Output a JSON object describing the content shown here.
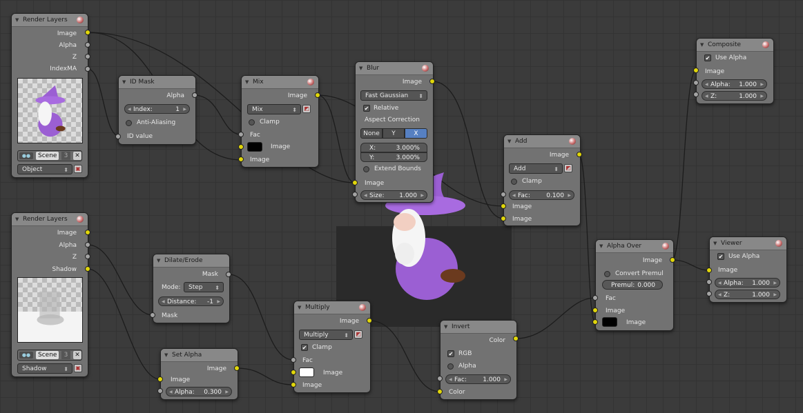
{
  "nodes": {
    "render_layers_1": {
      "title": "Render Layers",
      "outputs": [
        "Image",
        "Alpha",
        "Z",
        "IndexMA"
      ],
      "scene_name": "Scene",
      "scene_users": "3",
      "layer_select": "Object"
    },
    "id_mask": {
      "title": "ID Mask",
      "output": "Alpha",
      "index_label": "Index:",
      "index_value": "1",
      "anti_aliasing": "Anti-Aliasing",
      "input": "ID value"
    },
    "mix": {
      "title": "Mix",
      "output": "Image",
      "blend": "Mix",
      "clamp": "Clamp",
      "inputs": [
        "Fac",
        "Image",
        "Image"
      ]
    },
    "blur": {
      "title": "Blur",
      "output": "Image",
      "filter": "Fast Gaussian",
      "relative": "Relative",
      "aspect_label": "Aspect Correction",
      "aspect_options": [
        "None",
        "Y",
        "X"
      ],
      "x_label": "X:",
      "x_value": "3.000%",
      "y_label": "Y:",
      "y_value": "3.000%",
      "extend_bounds": "Extend Bounds",
      "input": "Image",
      "size_label": "Size:",
      "size_value": "1.000"
    },
    "add": {
      "title": "Add",
      "output": "Image",
      "blend": "Add",
      "clamp": "Clamp",
      "fac_label": "Fac:",
      "fac_value": "0.100",
      "inputs": [
        "Image",
        "Image"
      ]
    },
    "composite": {
      "title": "Composite",
      "use_alpha": "Use Alpha",
      "input": "Image",
      "alpha_label": "Alpha:",
      "alpha_value": "1.000",
      "z_label": "Z:",
      "z_value": "1.000"
    },
    "render_layers_2": {
      "title": "Render Layers",
      "outputs": [
        "Image",
        "Alpha",
        "Z",
        "Shadow"
      ],
      "scene_name": "Scene",
      "scene_users": "3",
      "layer_select": "Shadow"
    },
    "dilate_erode": {
      "title": "Dilate/Erode",
      "output": "Mask",
      "mode_label": "Mode:",
      "mode_value": "Step",
      "distance_label": "Distance:",
      "distance_value": "-1",
      "input": "Mask"
    },
    "set_alpha": {
      "title": "Set Alpha",
      "output": "Image",
      "input": "Image",
      "alpha_label": "Alpha:",
      "alpha_value": "0.300"
    },
    "multiply": {
      "title": "Multiply",
      "output": "Image",
      "blend": "Multiply",
      "clamp": "Clamp",
      "inputs": [
        "Fac",
        "Image",
        "Image"
      ]
    },
    "invert": {
      "title": "Invert",
      "output": "Color",
      "rgb": "RGB",
      "alpha": "Alpha",
      "fac_label": "Fac:",
      "fac_value": "1.000",
      "input": "Color"
    },
    "alpha_over": {
      "title": "Alpha Over",
      "output": "Image",
      "convert_premul": "Convert Premul",
      "premul_label": "Premul:",
      "premul_value": "0.000",
      "inputs": [
        "Fac",
        "Image",
        "Image"
      ]
    },
    "viewer": {
      "title": "Viewer",
      "use_alpha": "Use Alpha",
      "input": "Image",
      "alpha_label": "Alpha:",
      "alpha_value": "1.000",
      "z_label": "Z:",
      "z_value": "1.000"
    }
  },
  "colors": {
    "socket_color": "#e0d60a",
    "socket_value": "#a3a3a3",
    "node_body": "#727272",
    "node_header": "#888888",
    "wizard_purple": "#9b5fd3",
    "selected_button": "#5680c2"
  }
}
